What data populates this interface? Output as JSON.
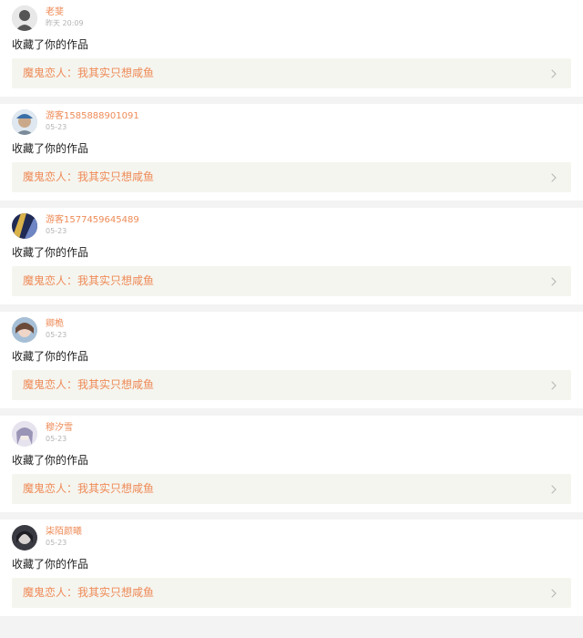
{
  "notifications": [
    {
      "user": "老斐",
      "time": "昨天 20:09",
      "action": "收藏了你的作品",
      "work_title": "魔鬼恋人：我其实只想咸鱼",
      "avatar_color": "#555555"
    },
    {
      "user": "游客1585888901091",
      "time": "05-23",
      "action": "收藏了你的作品",
      "work_title": "魔鬼恋人：我其实只想咸鱼",
      "avatar_color": "#c9a98a"
    },
    {
      "user": "游客1577459645489",
      "time": "05-23",
      "action": "收藏了你的作品",
      "work_title": "魔鬼恋人：我其实只想咸鱼",
      "avatar_color": "#2c3a6e"
    },
    {
      "user": "卿桅",
      "time": "05-23",
      "action": "收藏了你的作品",
      "work_title": "魔鬼恋人：我其实只想咸鱼",
      "avatar_color": "#a6bfd6"
    },
    {
      "user": "穆汐雪",
      "time": "05-23",
      "action": "收藏了你的作品",
      "work_title": "魔鬼恋人：我其实只想咸鱼",
      "avatar_color": "#c7c3d8"
    },
    {
      "user": "柒陌颜曦",
      "time": "05-23",
      "action": "收藏了你的作品",
      "work_title": "魔鬼恋人：我其实只想咸鱼",
      "avatar_color": "#4a4a52"
    }
  ],
  "colors": {
    "accent": "#ee8b58",
    "time": "#b3b3b3",
    "card_bg": "#ffffff",
    "work_bg": "#f5f5ef",
    "separator": "#f3f3f3"
  },
  "icons": {
    "avatar": "user-avatar",
    "chevron": "chevron-right-icon"
  }
}
